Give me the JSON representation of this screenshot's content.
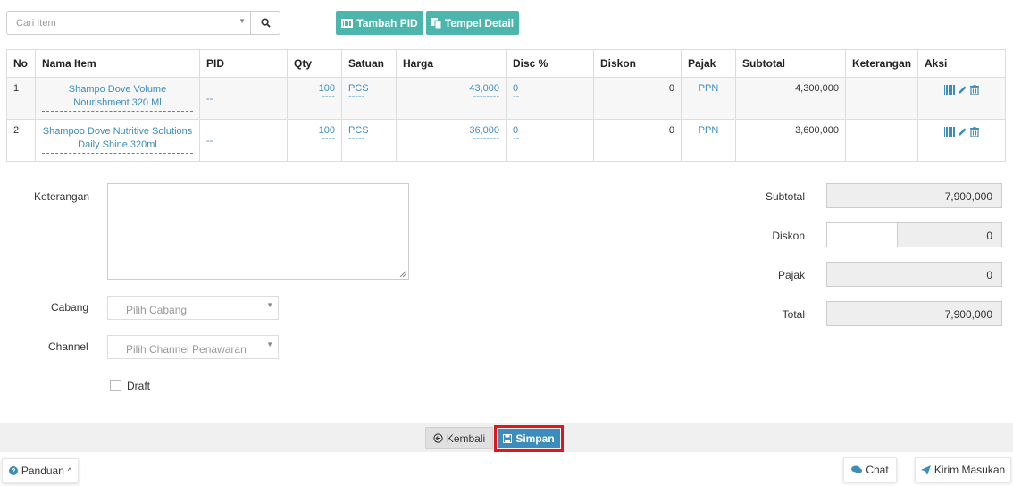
{
  "search": {
    "placeholder": "Cari Item"
  },
  "toolbar": {
    "tambah_pid": "Tambah PID",
    "tempel_detail": "Tempel Detail"
  },
  "table": {
    "headers": [
      "No",
      "Nama Item",
      "PID",
      "Qty",
      "Satuan",
      "Harga",
      "Disc %",
      "Diskon",
      "Pajak",
      "Subtotal",
      "Keterangan",
      "Aksi"
    ],
    "rows": [
      {
        "no": "1",
        "name_line1": "Shampo Dove Volume",
        "name_line2": "Nourishment 320 Ml",
        "pid": "--",
        "qty": "100",
        "qty_dash": "----",
        "satuan": "PCS",
        "satuan_dash": "-----",
        "harga": "43,000",
        "harga_dash": "--------",
        "disc": "0",
        "disc_dash": "--",
        "diskon": "0",
        "pajak": "PPN",
        "subtotal": "4,300,000",
        "keterangan": ""
      },
      {
        "no": "2",
        "name_line1": "Shampoo Dove Nutritive Solutions",
        "name_line2": "Daily Shine 320ml",
        "pid": "--",
        "qty": "100",
        "qty_dash": "----",
        "satuan": "PCS",
        "satuan_dash": "-----",
        "harga": "36,000",
        "harga_dash": "--------",
        "disc": "0",
        "disc_dash": "--",
        "diskon": "0",
        "pajak": "PPN",
        "subtotal": "3,600,000",
        "keterangan": ""
      }
    ]
  },
  "form": {
    "keterangan_label": "Keterangan",
    "cabang_label": "Cabang",
    "cabang_placeholder": "Pilih Cabang",
    "channel_label": "Channel",
    "channel_placeholder": "Pilih Channel Penawaran",
    "draft_label": "Draft"
  },
  "totals": {
    "subtotal_label": "Subtotal",
    "subtotal_value": "7,900,000",
    "diskon_label": "Diskon",
    "diskon_value": "0",
    "pajak_label": "Pajak",
    "pajak_value": "0",
    "total_label": "Total",
    "total_value": "7,900,000"
  },
  "footer": {
    "kembali": "Kembali",
    "simpan": "Simpan",
    "panduan": "Panduan",
    "chat": "Chat",
    "kirim_masukan": "Kirim Masukan"
  },
  "colors": {
    "accent": "#3c8dbc",
    "teal": "#4db6ac",
    "highlight": "#e0161d"
  }
}
